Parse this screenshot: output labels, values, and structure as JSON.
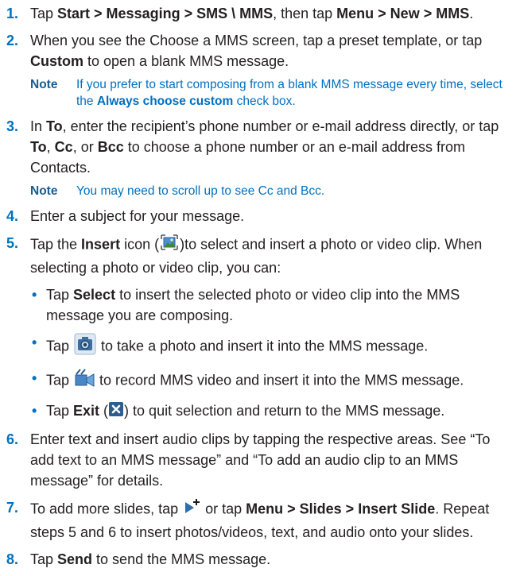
{
  "steps": [
    {
      "num": "1.",
      "pre": "Tap ",
      "b1": "Start > Messaging > SMS \\ MMS",
      "mid": ", then tap ",
      "b2": "Menu > New > MMS",
      "post": "."
    },
    {
      "num": "2.",
      "pre": "When you see the Choose a MMS screen, tap a preset template, or tap ",
      "b1": "Custom",
      "post": " to open a blank MMS message.",
      "note": {
        "label": "Note",
        "pre": "If you prefer to start composing from a blank MMS message every time, select the ",
        "b": "Always choose custom",
        "post": " check box."
      }
    },
    {
      "num": "3.",
      "t1": "In ",
      "b1": "To",
      "t2": ", enter the recipient’s phone number or e-mail address directly, or tap ",
      "b2": "To",
      "t3": ", ",
      "b3": "Cc",
      "t4": ", or ",
      "b4": "Bcc",
      "t5": " to choose a phone number or an e-mail address from Contacts.",
      "note": {
        "label": "Note",
        "text": "You may need to scroll up to see Cc and Bcc."
      }
    },
    {
      "num": "4.",
      "text": "Enter a subject for your message."
    },
    {
      "num": "5.",
      "t1": "Tap the ",
      "b1": "Insert",
      "t2": " icon (",
      "t3": ")to select and insert a photo or video clip. When selecting a photo or video clip, you can:",
      "bullets": [
        {
          "pre": "Tap ",
          "b": "Select",
          "post": " to insert the selected photo or video clip into the MMS message you are composing."
        },
        {
          "pre": "Tap ",
          "post": " to take a photo and insert it into the MMS message."
        },
        {
          "pre": "Tap ",
          "post": " to record MMS video and insert it into the MMS message."
        },
        {
          "pre": "Tap ",
          "b": "Exit",
          "mid": " (",
          "post": ") to quit selection and return to the MMS message."
        }
      ]
    },
    {
      "num": "6.",
      "text": "Enter text and insert audio clips by tapping the respective areas. See “To add text to an MMS message” and “To add an audio clip to an MMS message” for details."
    },
    {
      "num": "7.",
      "t1": "To add more slides, tap ",
      "t2": " or tap ",
      "b1": "Menu > Slides > Insert Slide",
      "t3": ". Repeat steps 5 and 6 to insert photos/videos, text, and audio onto your slides."
    },
    {
      "num": "8.",
      "t1": "Tap ",
      "b1": "Send",
      "t2": " to send the MMS message."
    }
  ],
  "icons": {
    "insert": "insert-media-icon",
    "camera": "camera-icon",
    "video": "video-camera-icon",
    "exit": "exit-x-icon",
    "slide": "insert-slide-icon"
  },
  "colors": {
    "accent": "#0070c0",
    "text": "#231f20"
  },
  "bullet_char": "•"
}
